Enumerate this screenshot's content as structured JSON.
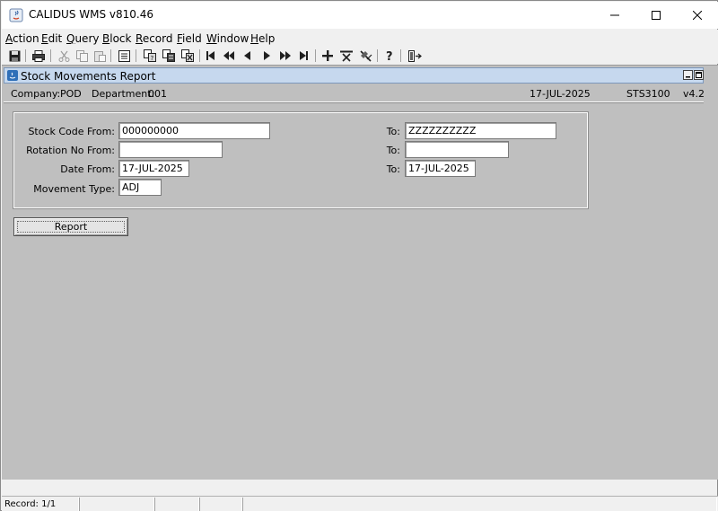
{
  "window": {
    "title": "CALIDUS WMS v810.46"
  },
  "menu": [
    {
      "label": "Action",
      "accel": "A",
      "rest": "ction"
    },
    {
      "label": "Edit",
      "accel": "E",
      "rest": "dit"
    },
    {
      "label": "Query",
      "accel": "Q",
      "rest": "uery"
    },
    {
      "label": "Block",
      "accel": "B",
      "rest": "lock"
    },
    {
      "label": "Record",
      "accel": "R",
      "rest": "ecord"
    },
    {
      "label": "Field",
      "accel": "F",
      "rest": "ield"
    },
    {
      "label": "Window",
      "accel": "W",
      "rest": "indow"
    },
    {
      "label": "Help",
      "accel": "H",
      "rest": "elp"
    }
  ],
  "toolbar": {
    "icons": [
      "save-icon",
      "print-icon",
      "cut-icon",
      "copy-icon",
      "paste-icon",
      "list-icon",
      "enter-query-icon",
      "execute-query-icon",
      "cancel-query-icon",
      "first-record-icon",
      "previous-block-icon",
      "previous-record-icon",
      "next-record-icon",
      "next-block-icon",
      "last-record-icon",
      "insert-record-icon",
      "delete-record-icon",
      "clear-record-icon",
      "help-icon",
      "exit-icon"
    ]
  },
  "form": {
    "title": "Stock Movements Report",
    "company_label": "Company:",
    "company_value": "POD",
    "department_label": "Department:",
    "department_value": "001",
    "date": "17-JUL-2025",
    "module": "STS3100",
    "version": "v4.2"
  },
  "fields": {
    "stock_code_from_label": "Stock Code From:",
    "stock_code_from": "000000000",
    "stock_code_to_label": "To:",
    "stock_code_to": "ZZZZZZZZZZ",
    "rotation_from_label": "Rotation No From:",
    "rotation_from": "",
    "rotation_to_label": "To:",
    "rotation_to": "",
    "date_from_label": "Date From:",
    "date_from": "17-JUL-2025",
    "date_to_label": "To:",
    "date_to": "17-JUL-2025",
    "movement_type_label": "Movement Type:",
    "movement_type": "ADJ"
  },
  "buttons": {
    "report_label": "Report"
  },
  "status": {
    "record": "Record: 1/1"
  }
}
